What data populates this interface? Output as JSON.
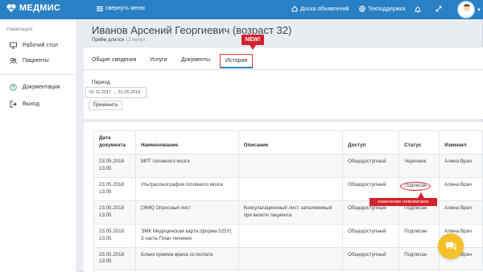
{
  "topbar": {
    "brand": "МЕДМИС",
    "collapse_label": "свернуть меню",
    "board_label": "Доска объявлений",
    "support_label": "Техподдержка"
  },
  "sidebar": {
    "title": "Навигация",
    "items": [
      {
        "label": "Рабочий стол",
        "icon": "monitor-icon"
      },
      {
        "label": "Пациенты",
        "icon": "users-icon"
      },
      {
        "label": "Документация",
        "icon": "help-circle-icon"
      },
      {
        "label": "Выход",
        "icon": "logout-icon"
      }
    ]
  },
  "patient": {
    "name": "Иванов Арсений Георгиевич (возраст 32)",
    "visit_prefix": "Приём длился",
    "visit_duration": "12 минут"
  },
  "tabs": [
    "Общие сведения",
    "Услуги",
    "Документы",
    "История"
  ],
  "active_tab": "История",
  "new_badge": "NEW!",
  "filter": {
    "period_label": "Период",
    "period_value": "01.11.2017 → 31.05.2018",
    "apply_label": "Применить"
  },
  "table": {
    "headers": [
      "Дата документа",
      "Наименование",
      "Описание",
      "Доступ",
      "Статус",
      "Изменил"
    ],
    "rows": [
      {
        "date": "23.05.2018",
        "time": "13:05",
        "name": "МРТ головного мозга",
        "desc": "",
        "access": "Общедоступный",
        "status": "Черновик",
        "changed": "Алина Врач"
      },
      {
        "date": "23.05.2018",
        "time": "13:05",
        "name": "Ультрасонография головного мозга",
        "desc": "",
        "access": "Общедоступный",
        "status": "Подписан",
        "changed": "Алина Врач"
      },
      {
        "date": "23.05.2018",
        "time": "13:05",
        "name": "[ЭМК] Опросный лист",
        "desc": "Консультационный лист заполняемый при визите пациента",
        "access": "Общедоступный",
        "status": "Подписан",
        "changed": "Алина Врач"
      },
      {
        "date": "23.05.2018",
        "time": "13:05",
        "name": "ЭМК Медицинская карта (форма 025У) 3 часть План лечения",
        "desc": "",
        "access": "Общедоступный",
        "status": "Подписан",
        "changed": "Алина Врач"
      },
      {
        "date": "23.05.2018",
        "time": "13:05",
        "name": "Бланк приема врача остеопата",
        "desc": "",
        "access": "Общедоступный",
        "status": "Подписан",
        "changed": "Алина Врач"
      }
    ]
  },
  "tooltip": "изменение невозможно",
  "colors": {
    "primary": "#2a80c4",
    "alert": "#d3222a",
    "chat": "#f5c02a"
  }
}
